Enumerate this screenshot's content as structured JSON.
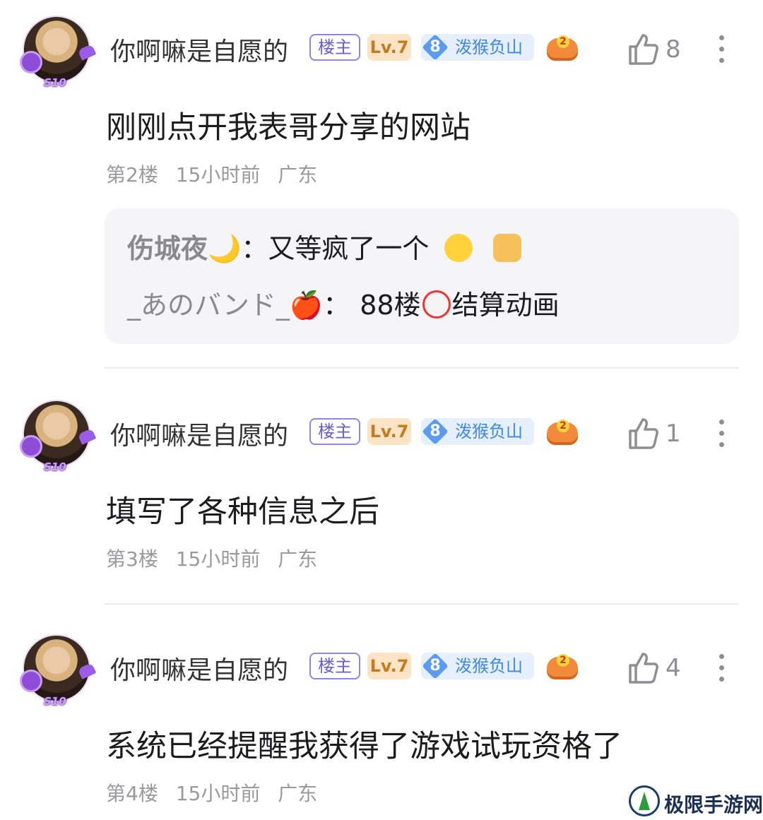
{
  "posts": [
    {
      "user": {
        "name": "你啊嘛是自愿的",
        "owner_badge": "楼主",
        "level": "Lv.7",
        "rank_num": "8",
        "rank_title": "泼猴负山",
        "game_badge_num": "2",
        "avatar_tag": "S10"
      },
      "likes": "8",
      "content": "刚刚点开我表哥分享的网站",
      "floor": "第2楼",
      "time": "15小时前",
      "location": "广东",
      "replies": [
        {
          "name": "伤城夜🌙",
          "sep": "：",
          "text": "又等疯了一个",
          "emojis": [
            "laughing-face",
            "dog-face"
          ]
        },
        {
          "name": "_あのバンド_🍎",
          "sep": "：",
          "text_before": "88楼",
          "text_after": "结算动画",
          "emojis": [
            "clown-face"
          ]
        }
      ]
    },
    {
      "user": {
        "name": "你啊嘛是自愿的",
        "owner_badge": "楼主",
        "level": "Lv.7",
        "rank_num": "8",
        "rank_title": "泼猴负山",
        "game_badge_num": "2",
        "avatar_tag": "S10"
      },
      "likes": "1",
      "content": "填写了各种信息之后",
      "floor": "第3楼",
      "time": "15小时前",
      "location": "广东"
    },
    {
      "user": {
        "name": "你啊嘛是自愿的",
        "owner_badge": "楼主",
        "level": "Lv.7",
        "rank_num": "8",
        "rank_title": "泼猴负山",
        "game_badge_num": "2",
        "avatar_tag": "S10"
      },
      "likes": "4",
      "content": "系统已经提醒我获得了游戏试玩资格了",
      "floor": "第4楼",
      "time": "15小时前",
      "location": "广东"
    }
  ],
  "watermark": {
    "text": "极限手游网"
  },
  "colors": {
    "owner_badge": "#6a5fd1",
    "level_badge_bg": "#fbe4c6",
    "rank_badge_bg": "#e6f0fd",
    "reply_bg": "#f5f5f7",
    "meta_text": "#9a9a9e"
  }
}
